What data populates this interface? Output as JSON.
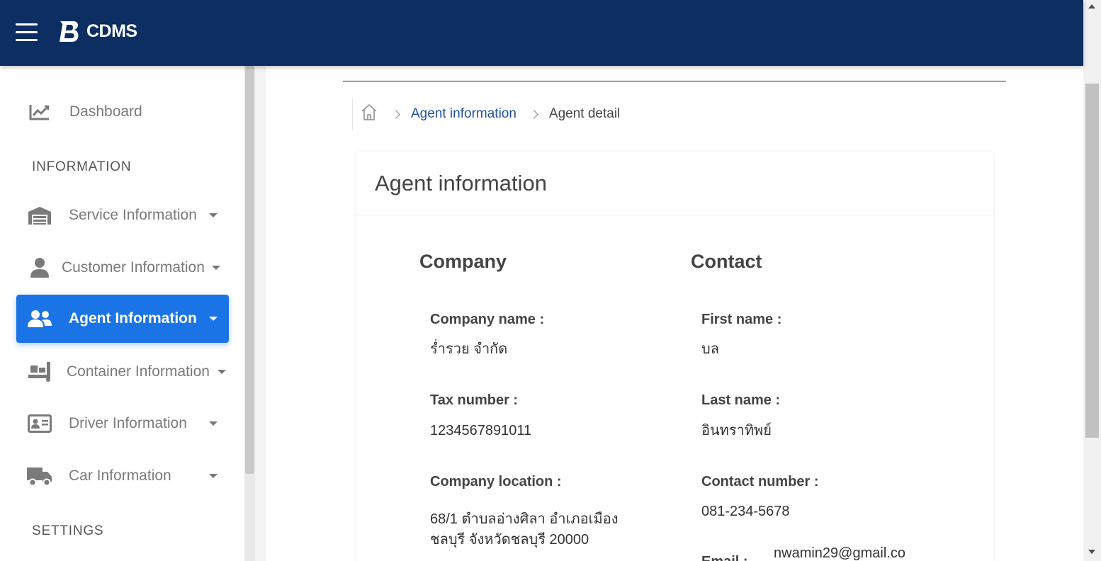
{
  "header": {
    "brand": "CDMS",
    "colors": {
      "topbar": "#0d2e63",
      "active": "#1a74e6",
      "link": "#1e4fa6"
    }
  },
  "sidebar": {
    "dashboard": {
      "label": "Dashboard",
      "icon": "chart-line-icon"
    },
    "information_heading": "INFORMATION",
    "items": [
      {
        "label": "Service Information",
        "icon": "warehouse-icon"
      },
      {
        "label": "Customer Information",
        "icon": "user-icon"
      },
      {
        "label": "Agent Information",
        "icon": "users-icon",
        "active": true
      },
      {
        "label": "Container Information",
        "icon": "dolly-icon"
      },
      {
        "label": "Driver Information",
        "icon": "id-card-icon"
      },
      {
        "label": "Car Information",
        "icon": "truck-icon"
      }
    ],
    "settings_heading": "SETTINGS"
  },
  "breadcrumb": {
    "home_icon": "home-icon",
    "link": "Agent information",
    "current": "Agent detail"
  },
  "card": {
    "title": "Agent information",
    "company": {
      "heading": "Company",
      "name_label": "Company name :",
      "name_value": "ร่ำรวย จำกัด",
      "tax_label": "Tax number :",
      "tax_value": "1234567891011",
      "location_label": "Company location :",
      "location_line1": "68/1 ตำบลอ่างศิลา อำเภอเมือง",
      "location_line2": "ชลบุรี จังหวัดชลบุรี 20000"
    },
    "contact": {
      "heading": "Contact",
      "first_label": "First name :",
      "first_value": "บล",
      "last_label": "Last name :",
      "last_value": "อินทราทิพย์",
      "phone_label": "Contact number :",
      "phone_value": "081-234-5678",
      "email_label": "Email :",
      "email_value": "nwamin29@gmail.co"
    }
  }
}
